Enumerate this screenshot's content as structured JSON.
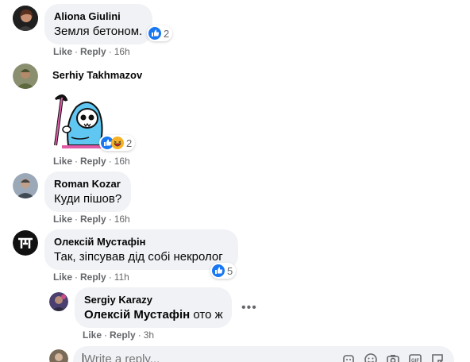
{
  "comments": [
    {
      "author": "Aliona Giulini",
      "text": "Земля бетоном.",
      "reaction_count": "2",
      "actions": {
        "like": "Like",
        "reply": "Reply",
        "time": "16h"
      }
    },
    {
      "author": "Serhiy Takhmazov",
      "sticker": "grim-reaper-sticker",
      "reaction_count": "2",
      "actions": {
        "like": "Like",
        "reply": "Reply",
        "time": "16h"
      }
    },
    {
      "author": "Roman Kozar",
      "text": "Куди пішов?",
      "actions": {
        "like": "Like",
        "reply": "Reply",
        "time": "16h"
      }
    },
    {
      "author": "Олексій Мустафін",
      "text": "Так, зіпсував дід собі некролог",
      "reaction_count": "5",
      "actions": {
        "like": "Like",
        "reply": "Reply",
        "time": "11h"
      }
    }
  ],
  "reply": {
    "author": "Sergiy Karazy",
    "mention": "Олексій Мустафін",
    "text": " ото ж",
    "more": "•••",
    "actions": {
      "like": "Like",
      "reply": "Reply",
      "time": "3h"
    }
  },
  "reply_box": {
    "placeholder": "Write a reply..."
  },
  "colors": {
    "bubble": "#f0f2f5",
    "like_blue": "#1877f2",
    "haha_yellow": "#f7b125",
    "meta_gray": "#65676b"
  }
}
